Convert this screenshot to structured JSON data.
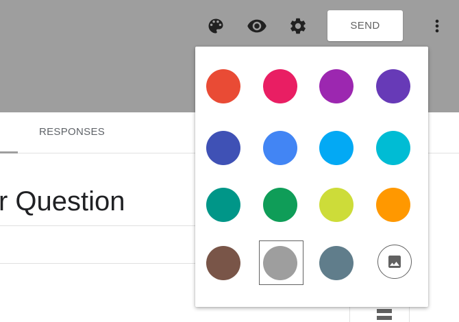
{
  "toolbar": {
    "send_label": "SEND",
    "icons": [
      "palette-icon",
      "eye-icon",
      "gear-icon",
      "more-vert-icon"
    ]
  },
  "tabs": {
    "responses_label": "RESPONSES"
  },
  "form": {
    "title": "r Question"
  },
  "theme_palette": {
    "colors": [
      "#e94b35",
      "#e91e63",
      "#9c27b0",
      "#673ab7",
      "#3f51b5",
      "#4285f4",
      "#03a9f4",
      "#00bcd4",
      "#009688",
      "#0f9d58",
      "#cddc39",
      "#ff9800",
      "#795548",
      "#9e9e9e",
      "#607d8b"
    ],
    "selected_color": "#9e9e9e",
    "image_option_icon": "image-icon"
  },
  "colors": {
    "header_bg": "#9e9e9e",
    "icon_color": "#212121"
  }
}
